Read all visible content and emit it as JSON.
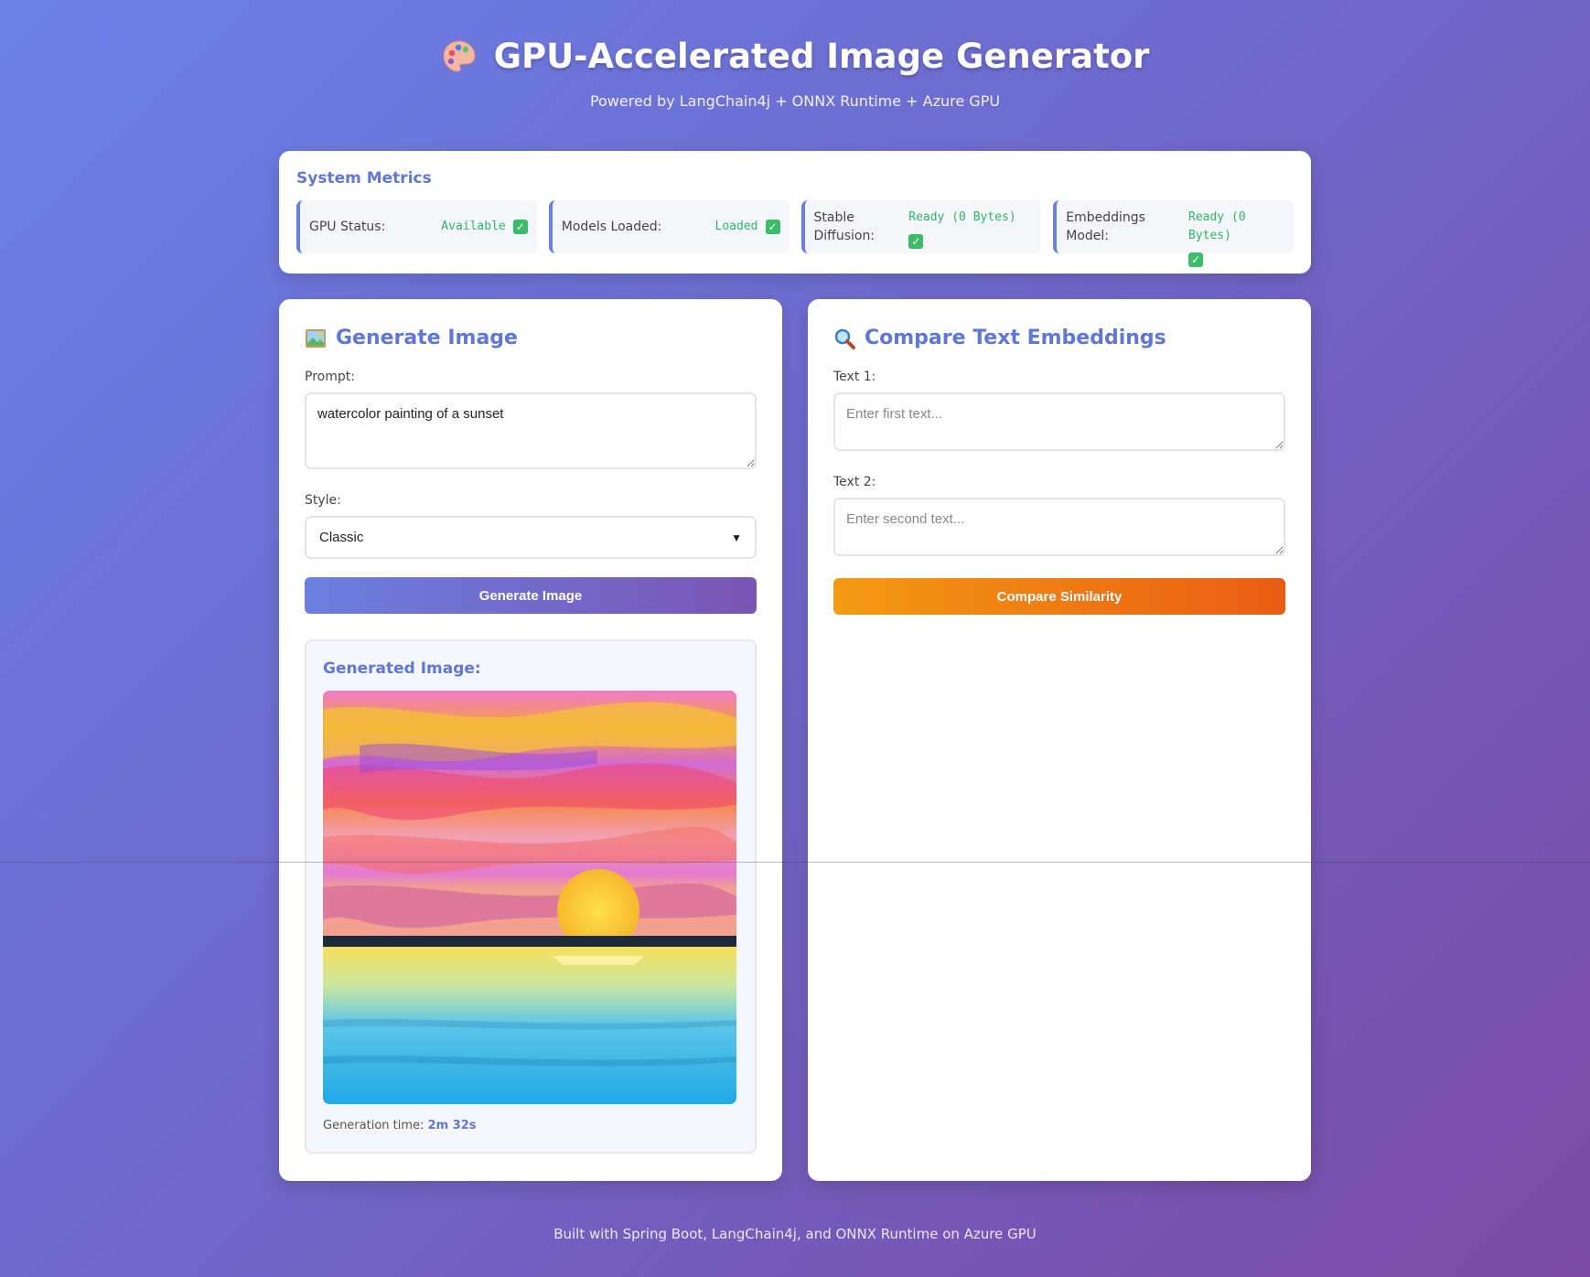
{
  "header": {
    "icon": "palette-icon",
    "title": "GPU-Accelerated Image Generator",
    "subtitle": "Powered by LangChain4j + ONNX Runtime + Azure GPU"
  },
  "metrics": {
    "title": "System Metrics",
    "items": [
      {
        "label": "GPU Status:",
        "value": "Available",
        "status": "check-icon"
      },
      {
        "label": "Models Loaded:",
        "value": "Loaded",
        "status": "check-icon"
      },
      {
        "label": "Stable Diffusion:",
        "value": "Ready (0 Bytes)",
        "status": "check-icon"
      },
      {
        "label": "Embeddings Model:",
        "value": "Ready (0 Bytes)",
        "status": "check-icon"
      }
    ]
  },
  "generate": {
    "icon": "image-icon",
    "title": "Generate Image",
    "prompt_label": "Prompt:",
    "prompt_value": "watercolor painting of a sunset",
    "style_label": "Style:",
    "style_value": "Classic",
    "button": "Generate Image",
    "result_title": "Generated Image:",
    "image_alt": "watercolor painting of a sunset",
    "time_label": "Generation time:",
    "time_value": "2m 32s"
  },
  "compare": {
    "icon": "search-icon",
    "title": "Compare Text Embeddings",
    "text1_label": "Text 1:",
    "text1_placeholder": "Enter first text...",
    "text2_label": "Text 2:",
    "text2_placeholder": "Enter second text...",
    "button": "Compare Similarity"
  },
  "footer": "Built with Spring Boot, LangChain4j, and ONNX Runtime on Azure GPU",
  "colors": {
    "accent": "#6077d6",
    "success": "#2fb56a",
    "compare_start": "#f39a12",
    "compare_end": "#ea5c14"
  }
}
